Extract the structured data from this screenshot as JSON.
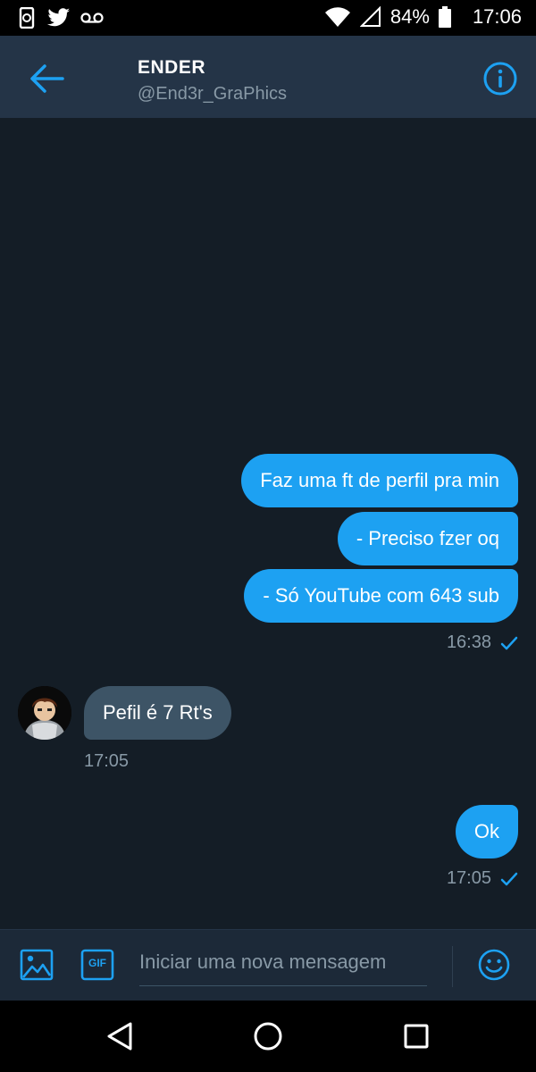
{
  "status_bar": {
    "battery": "84%",
    "time": "17:06"
  },
  "header": {
    "name": "ENDER",
    "handle": "@End3r_GraPhics"
  },
  "messages": [
    {
      "direction": "out",
      "text": "Faz uma ft de perfil pra min"
    },
    {
      "direction": "out",
      "text": "- Preciso fzer oq"
    },
    {
      "direction": "out",
      "text": "- Só YouTube com 643 sub"
    },
    {
      "direction": "in",
      "text": "Pefil é 7 Rt's"
    },
    {
      "direction": "out",
      "text": "Ok"
    }
  ],
  "timestamps": {
    "group1": "16:38",
    "group2": "17:05",
    "group3": "17:05"
  },
  "composer": {
    "placeholder": "Iniciar uma nova mensagem",
    "gif_label": "GIF"
  },
  "colors": {
    "accent": "#1da1f2",
    "background": "#141d26",
    "header": "#243447",
    "incoming_bubble": "#3d5466",
    "muted_text": "#8899a6"
  }
}
